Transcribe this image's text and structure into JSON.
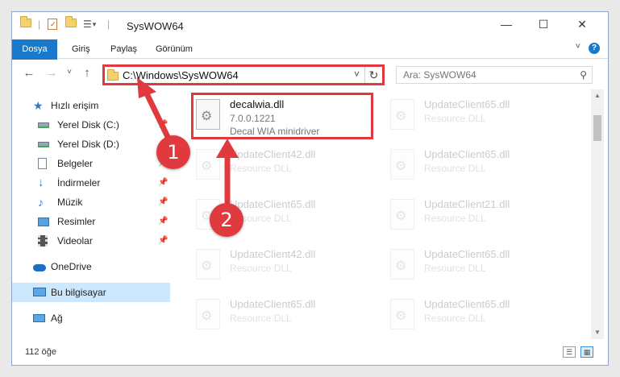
{
  "window": {
    "title": "SysWOW64",
    "controls": {
      "minimize": "—",
      "maximize": "☐",
      "close": "✕"
    }
  },
  "ribbon": {
    "tabs": [
      "Dosya",
      "Giriş",
      "Paylaş",
      "Görünüm"
    ],
    "help_label": "?",
    "collapse_label": "˅"
  },
  "navigation": {
    "back": "←",
    "forward": "→",
    "recent": "˅",
    "up": "↑",
    "address_path": "C:\\Windows\\SysWOW64",
    "address_dropdown": "˅",
    "refresh": "↻",
    "search_placeholder": "Ara: SysWOW64",
    "search_icon": "⚲"
  },
  "sidebar": {
    "items": [
      {
        "label": "Hızlı erişim",
        "icon": "star-icon"
      },
      {
        "label": "Yerel Disk (C:)",
        "icon": "drive-icon",
        "pinned": true
      },
      {
        "label": "Yerel Disk (D:)",
        "icon": "drive-icon",
        "pinned": true
      },
      {
        "label": "Belgeler",
        "icon": "documents-icon",
        "pinned": true
      },
      {
        "label": "İndirmeler",
        "icon": "download-icon",
        "pinned": true
      },
      {
        "label": "Müzik",
        "icon": "music-icon",
        "pinned": true
      },
      {
        "label": "Resimler",
        "icon": "pictures-icon",
        "pinned": true
      },
      {
        "label": "Videolar",
        "icon": "videos-icon",
        "pinned": true
      },
      {
        "label": "OneDrive",
        "icon": "cloud-icon"
      },
      {
        "label": "Bu bilgisayar",
        "icon": "computer-icon",
        "selected": true
      },
      {
        "label": "Ağ",
        "icon": "network-icon"
      }
    ],
    "pin_glyph": "📌"
  },
  "files": [
    {
      "name": "decalwia.dll",
      "version": "7.0.0.1221",
      "description": "Decal WIA minidriver",
      "highlighted": true
    },
    {
      "name": "UpdateClient65.dll",
      "description": "Resource DLL"
    },
    {
      "name": "UpdateClient42.dll",
      "description": "Resource DLL"
    },
    {
      "name": "UpdateClient65.dll",
      "description": "Resource DLL"
    },
    {
      "name": "UpdateClient65.dll",
      "description": "Resource DLL"
    },
    {
      "name": "UpdateClient21.dll",
      "description": "Resource DLL"
    },
    {
      "name": "UpdateClient42.dll",
      "description": "Resource DLL"
    },
    {
      "name": "UpdateClient65.dll",
      "description": "Resource DLL"
    },
    {
      "name": "UpdateClient65.dll",
      "description": "Resource DLL"
    },
    {
      "name": "UpdateClient65.dll",
      "description": "Resource DLL"
    }
  ],
  "status": {
    "item_count": "112 öğe"
  },
  "annotations": {
    "markers": [
      "1",
      "2"
    ],
    "color": "#e0393e"
  },
  "colors": {
    "accent": "#1979ca",
    "highlight": "#e0393e",
    "selected": "#cce8ff"
  }
}
